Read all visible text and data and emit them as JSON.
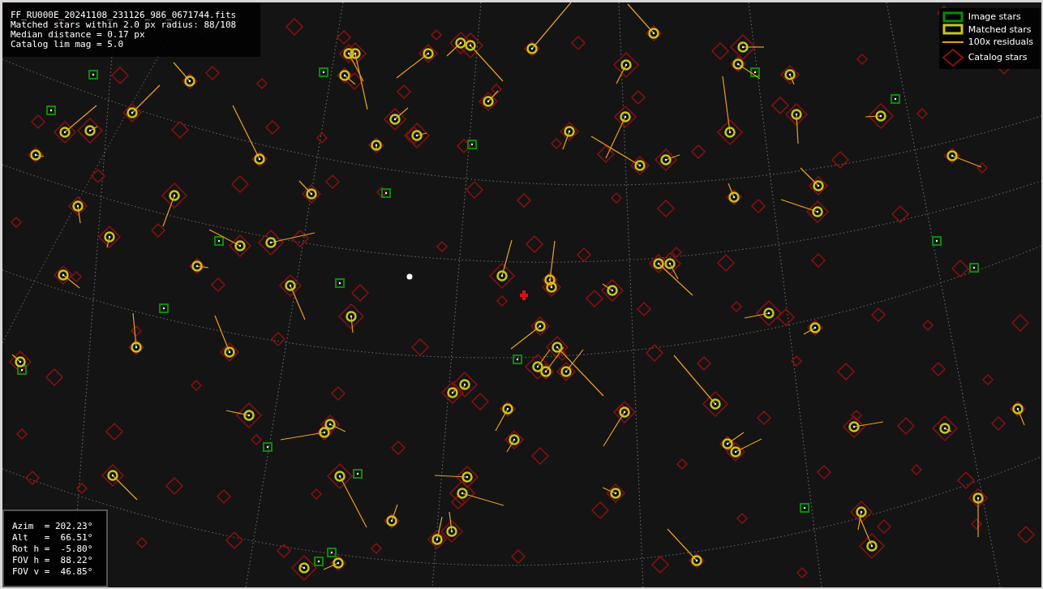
{
  "info": {
    "lines": [
      "FF_RU000E_20241108_231126_986_0671744.fits",
      "Matched stars within 2.0 px radius: 88/108",
      "Median distance = 0.17 px",
      "Catalog lim mag = 5.0"
    ]
  },
  "legend": [
    {
      "kind": "image",
      "label": "Image stars"
    },
    {
      "kind": "matched",
      "label": "Matched stars"
    },
    {
      "kind": "residual",
      "label": "100x residuals"
    },
    {
      "kind": "catalog",
      "label": "Catalog stars"
    }
  ],
  "pointing": {
    "lines": [
      "Azim  = 202.23°",
      "Alt   =  66.51°",
      "Rot h =  -5.80°",
      "FOV h =  88.22°",
      "FOV v =  46.85°"
    ]
  }
}
